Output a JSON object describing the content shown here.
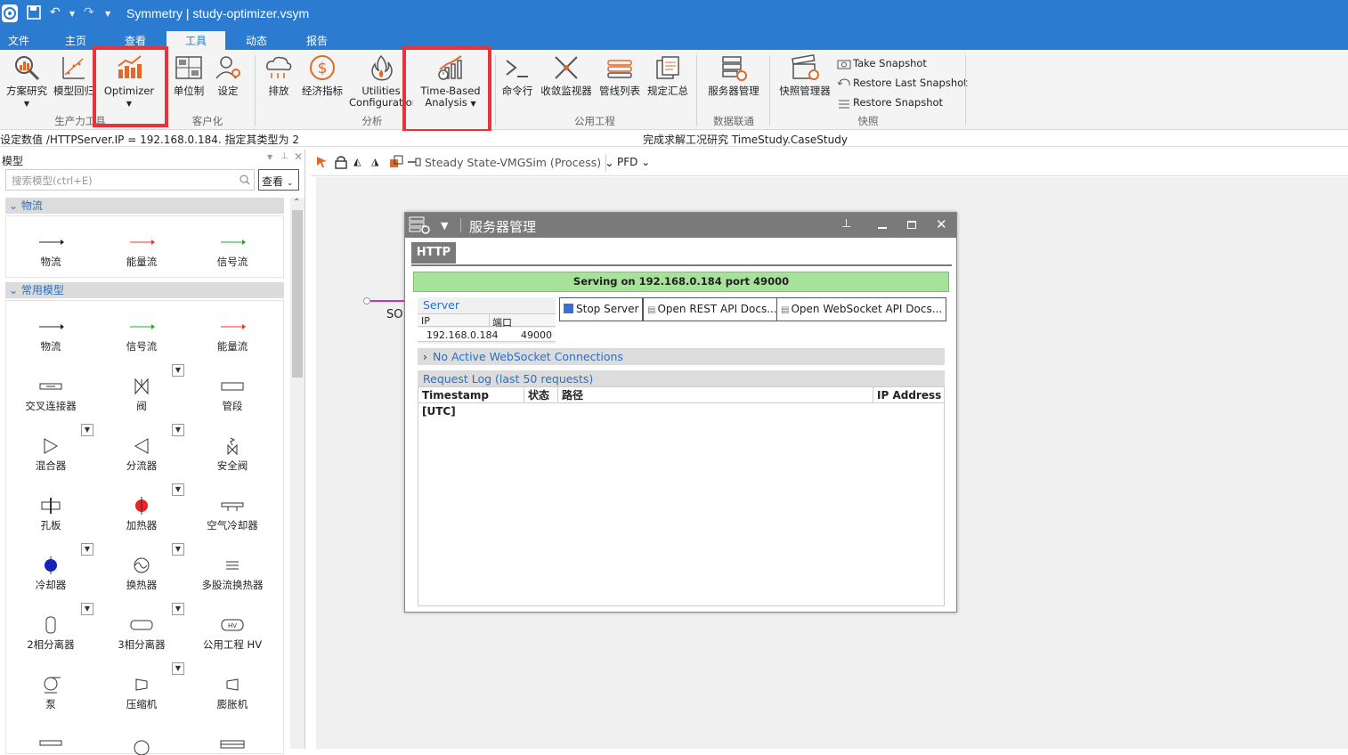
{
  "app": {
    "title": "Symmetry | study-optimizer.vsym",
    "colors": {
      "titlebar": "#2b7bd0",
      "highlight": "#e8333a",
      "serving_bg": "#a6e29a"
    }
  },
  "ribbon_tabs": [
    "文件",
    "主页",
    "查看",
    "工具",
    "动态",
    "报告"
  ],
  "ribbon": {
    "buttons": {
      "case_study": "方案研究",
      "model_regression": "模型回归",
      "optimizer": "Optimizer",
      "unit_system": "单位制",
      "settings": "设定",
      "emissions": "排放",
      "economics": "经济指标",
      "utilities_line1": "Utilities",
      "utilities_line2": "Configuration",
      "tba_line1": "Time-Based",
      "tba_line2": "Analysis",
      "command_line": "命令行",
      "convergence_monitor": "收敛监视器",
      "pipe_list": "管线列表",
      "spec_summary": "规定汇总",
      "server_manager": "服务器管理",
      "snapshot_manager": "快照管理器",
      "take_snapshot": "Take Snapshot",
      "restore_last_snapshot": "Restore Last Snapshot",
      "restore_snapshot": "Restore Snapshot"
    },
    "groups": {
      "productivity": "生产力工具",
      "customize": "客户化",
      "analysis": "分析",
      "utilities": "公用工程",
      "data_link": "数据联通",
      "snapshot": "快照"
    }
  },
  "status": {
    "left": "设定数值 /HTTPServer.IP = 192.168.0.184. 指定其类型为 2",
    "right": "完成求解工况研究 TimeStudy.CaseStudy"
  },
  "left_panel": {
    "title": "模型",
    "search_placeholder": "搜索模型(ctrl+E)",
    "view_button": "查看",
    "categories": [
      {
        "name": "物流",
        "items": [
          "物流",
          "能量流",
          "信号流"
        ]
      },
      {
        "name": "常用模型",
        "items": [
          "物流",
          "信号流",
          "能量流",
          "交叉连接器",
          "阀",
          "管段",
          "混合器",
          "分流器",
          "安全阀",
          "孔板",
          "加热器",
          "空气冷却器",
          "冷却器",
          "换热器",
          "多股流换热器",
          "2相分离器",
          "3相分离器",
          "公用工程 HV",
          "泵",
          "压缩机",
          "膨胀机"
        ]
      }
    ]
  },
  "canvas": {
    "toolbar_mode": "Steady State-VMGSim (Process)",
    "view_mode": "PFD",
    "stream_label": "SO"
  },
  "dialog": {
    "title": "服务器管理",
    "tab": "HTTP",
    "serving_text": "Serving on 192.168.0.184 port 49000",
    "server": {
      "section": "Server",
      "col_ip": "IP",
      "col_port": "端口",
      "ip": "192.168.0.184",
      "port": "49000"
    },
    "buttons": {
      "stop_server": "Stop Server",
      "rest_docs": "Open REST API Docs...",
      "ws_docs": "Open WebSocket API Docs..."
    },
    "ws_section": "No Active WebSocket Connections",
    "log_section": "Request Log (last 50 requests)",
    "log_columns": [
      "Timestamp [UTC]",
      "状态",
      "路径",
      "IP Address"
    ]
  }
}
